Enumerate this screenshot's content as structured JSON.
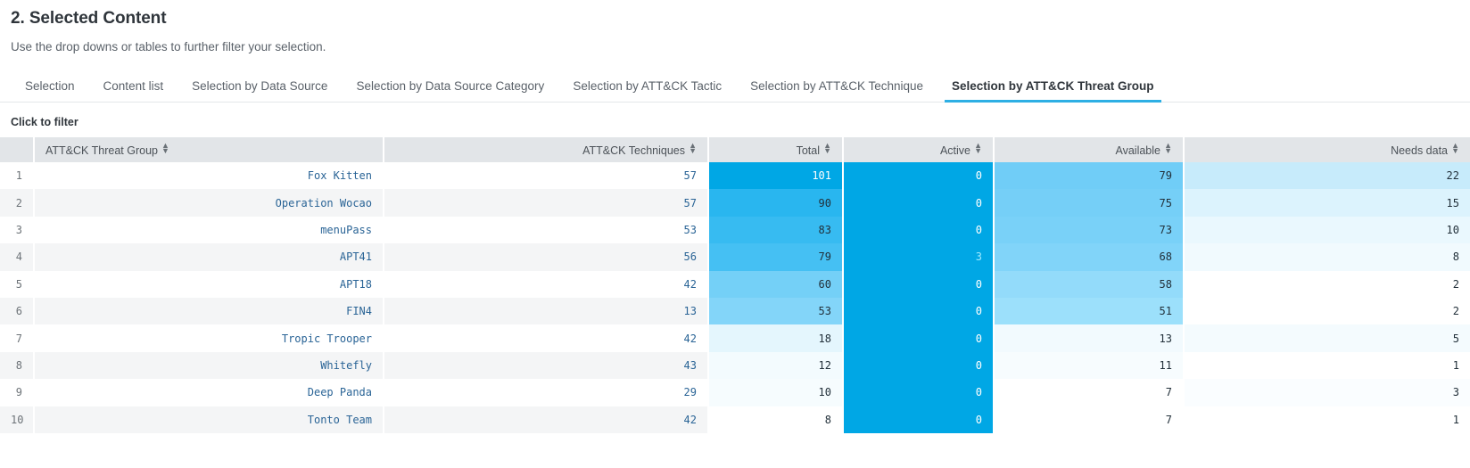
{
  "header": {
    "title": "2. Selected Content",
    "subtitle": "Use the drop downs or tables to further filter your selection."
  },
  "tabs": [
    {
      "label": "Selection",
      "active": false
    },
    {
      "label": "Content list",
      "active": false
    },
    {
      "label": "Selection by Data Source",
      "active": false
    },
    {
      "label": "Selection by Data Source Category",
      "active": false
    },
    {
      "label": "Selection by ATT&CK Tactic",
      "active": false
    },
    {
      "label": "Selection by ATT&CK Technique",
      "active": false
    },
    {
      "label": "Selection by ATT&CK Threat Group",
      "active": true
    }
  ],
  "filter_hint": "Click to filter",
  "table": {
    "columns": [
      {
        "key": "idx",
        "label": "",
        "align": "right",
        "sortable": false
      },
      {
        "key": "group",
        "label": "ATT&CK Threat Group",
        "align": "left",
        "sortable": true
      },
      {
        "key": "techniques",
        "label": "ATT&CK Techniques",
        "align": "right",
        "sortable": true
      },
      {
        "key": "total",
        "label": "Total",
        "align": "right",
        "sortable": true
      },
      {
        "key": "active",
        "label": "Active",
        "align": "right",
        "sortable": true
      },
      {
        "key": "available",
        "label": "Available",
        "align": "right",
        "sortable": true
      },
      {
        "key": "needs_data",
        "label": "Needs data",
        "align": "right",
        "sortable": true
      }
    ],
    "rows": [
      {
        "idx": "1",
        "group": "Fox Kitten",
        "techniques": "57",
        "total": "101",
        "active": "0",
        "available": "79",
        "needs_data": "22"
      },
      {
        "idx": "2",
        "group": "Operation Wocao",
        "techniques": "57",
        "total": "90",
        "active": "0",
        "available": "75",
        "needs_data": "15"
      },
      {
        "idx": "3",
        "group": "menuPass",
        "techniques": "53",
        "total": "83",
        "active": "0",
        "available": "73",
        "needs_data": "10"
      },
      {
        "idx": "4",
        "group": "APT41",
        "techniques": "56",
        "total": "79",
        "active": "3",
        "available": "68",
        "needs_data": "8"
      },
      {
        "idx": "5",
        "group": "APT18",
        "techniques": "42",
        "total": "60",
        "active": "0",
        "available": "58",
        "needs_data": "2"
      },
      {
        "idx": "6",
        "group": "FIN4",
        "techniques": "13",
        "total": "53",
        "active": "0",
        "available": "51",
        "needs_data": "2"
      },
      {
        "idx": "7",
        "group": "Tropic Trooper",
        "techniques": "42",
        "total": "18",
        "active": "0",
        "available": "13",
        "needs_data": "5"
      },
      {
        "idx": "8",
        "group": "Whitefly",
        "techniques": "43",
        "total": "12",
        "active": "0",
        "available": "11",
        "needs_data": "1"
      },
      {
        "idx": "9",
        "group": "Deep Panda",
        "techniques": "29",
        "total": "10",
        "active": "0",
        "available": "7",
        "needs_data": "3"
      },
      {
        "idx": "10",
        "group": "Tonto Team",
        "techniques": "42",
        "total": "8",
        "active": "0",
        "available": "7",
        "needs_data": "1"
      }
    ],
    "heatmap": {
      "accent": "#00A7E5",
      "total_cell_colors": [
        "#00a7e5",
        "#29b6ef",
        "#37bbf1",
        "#45c0f3",
        "#74d0f7",
        "#83d5f9",
        "#e4f6fd",
        "#f3fbfe",
        "#f6fcfe",
        "#ffffff"
      ],
      "active_cell_colors": [
        "#00a7e5",
        "#00a7e5",
        "#00a7e5",
        "#00a7e5",
        "#00a7e5",
        "#00a7e5",
        "#00a7e5",
        "#00a7e5",
        "#00a7e5",
        "#00a7e5"
      ],
      "available_cell_colors": [
        "#70cdf7",
        "#75cff7",
        "#79d1f8",
        "#81d4f9",
        "#93dbfa",
        "#9ce0fb",
        "#f2fafe",
        "#f7fcfe",
        "#ffffff",
        "#ffffff"
      ],
      "needs_data_cell_colors": [
        "#c7ebfb",
        "#dcf3fd",
        "#eaf8fe",
        "#f1fafe",
        "#ffffff",
        "#ffffff",
        "#f4fbfe",
        "#ffffff",
        "#fafdff",
        "#ffffff"
      ],
      "total_text_colors": [
        "#ffffff",
        "#22303a",
        "#22303a",
        "#22303a",
        "#22303a",
        "#22303a",
        "#22303a",
        "#22303a",
        "#22303a",
        "#22303a"
      ],
      "active_text_colors": [
        "#ffffff",
        "#ffffff",
        "#ffffff",
        "#9eeaff",
        "#ffffff",
        "#ffffff",
        "#ffffff",
        "#ffffff",
        "#ffffff",
        "#ffffff"
      ]
    }
  }
}
